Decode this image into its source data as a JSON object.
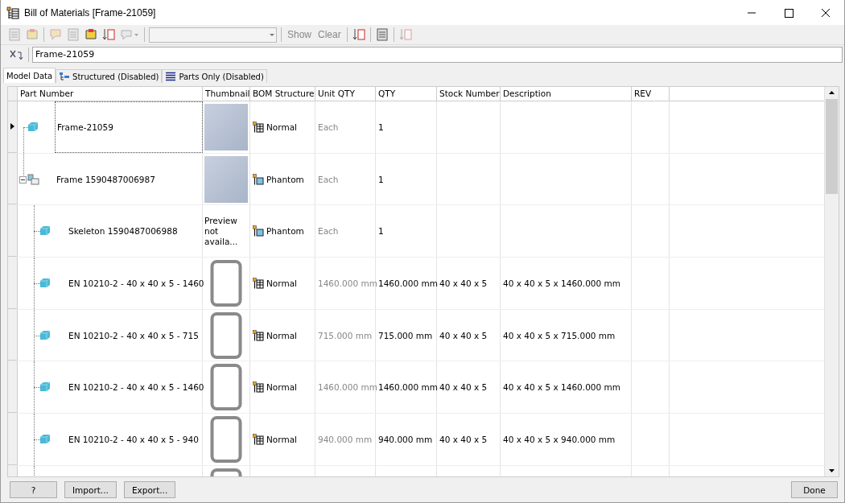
{
  "window": {
    "title": "Bill of Materials [Frame-21059]"
  },
  "toolbar": [
    {
      "kind": "icon",
      "disabled": true
    },
    {
      "kind": "icon",
      "disabled": true
    },
    {
      "kind": "separator"
    },
    {
      "kind": "icon",
      "disabled": true
    },
    {
      "kind": "icon",
      "disabled": true
    },
    {
      "kind": "icon",
      "disabled": false
    },
    {
      "kind": "icon",
      "disabled": false
    },
    {
      "kind": "dropdown-icon",
      "disabled": true
    },
    {
      "kind": "separator"
    },
    {
      "kind": "combo",
      "disabled": true
    },
    {
      "kind": "separator"
    },
    {
      "kind": "text",
      "label": "Show",
      "disabled": true
    },
    {
      "kind": "text",
      "label": "Clear",
      "disabled": true
    },
    {
      "kind": "separator"
    },
    {
      "kind": "icon",
      "disabled": false
    },
    {
      "kind": "separator"
    },
    {
      "kind": "icon",
      "disabled": false
    },
    {
      "kind": "separator"
    },
    {
      "kind": "icon",
      "disabled": true
    }
  ],
  "filter": {
    "value": "Frame-21059"
  },
  "tabs": [
    {
      "label": "Model Data",
      "selected": true
    },
    {
      "label": "Structured (Disabled)",
      "selected": false
    },
    {
      "label": "Parts Only (Disabled)",
      "selected": false
    }
  ],
  "columns": [
    "Part Number",
    "Thumbnail",
    "BOM Structure",
    "Unit QTY",
    "QTY",
    "Stock Number",
    "Description",
    "REV"
  ],
  "rows": [
    {
      "part_number": "Frame-21059",
      "thumbnail": {
        "kind": "image"
      },
      "bom_structure": "Normal",
      "unit_qty": "Each",
      "qty": "1",
      "selected": true
    },
    {
      "part_number": "Frame 1590487006987",
      "thumbnail": {
        "kind": "image"
      },
      "bom_structure": "Phantom",
      "unit_qty": "Each",
      "qty": "1",
      "selected": false,
      "expanded": true,
      "children": [
        {
          "part_number": "Skeleton 1590487006988",
          "thumbnail": {
            "kind": "text",
            "text": "Preview not availa..."
          },
          "bom_structure": "Phantom",
          "unit_qty": "Each",
          "qty": "1",
          "selected": false
        },
        {
          "part_number": "EN 10210-2 - 40 x 40 x 5 - 1460",
          "thumbnail": {
            "kind": "profile"
          },
          "bom_structure": "Normal",
          "unit_qty": "1460.000 mm",
          "qty": "1460.000 mm",
          "stock_number": "40 x 40 x 5",
          "description": "40 x 40 x 5 x 1460.000 mm",
          "selected": false
        },
        {
          "part_number": "EN 10210-2 - 40 x 40 x 5 - 715",
          "thumbnail": {
            "kind": "profile"
          },
          "bom_structure": "Normal",
          "unit_qty": "715.000 mm",
          "qty": "715.000 mm",
          "stock_number": "40 x 40 x 5",
          "description": "40 x 40 x 5 x 715.000 mm",
          "selected": false
        },
        {
          "part_number": "EN 10210-2 - 40 x 40 x 5 - 1460",
          "thumbnail": {
            "kind": "profile"
          },
          "bom_structure": "Normal",
          "unit_qty": "1460.000 mm",
          "qty": "1460.000 mm",
          "stock_number": "40 x 40 x 5",
          "description": "40 x 40 x 5 x 1460.000 mm",
          "selected": false
        },
        {
          "part_number": "EN 10210-2 - 40 x 40 x 5 - 940",
          "thumbnail": {
            "kind": "profile"
          },
          "bom_structure": "Normal",
          "unit_qty": "940.000 mm",
          "qty": "940.000 mm",
          "stock_number": "40 x 40 x 5",
          "description": "40 x 40 x 5 x 940.000 mm",
          "selected": false
        },
        {
          "thumbnail": {
            "kind": "profile"
          },
          "selected": false
        }
      ]
    }
  ],
  "footer": {
    "left_buttons": [
      "?",
      "Import...",
      "Export..."
    ],
    "right_button": "Done"
  }
}
